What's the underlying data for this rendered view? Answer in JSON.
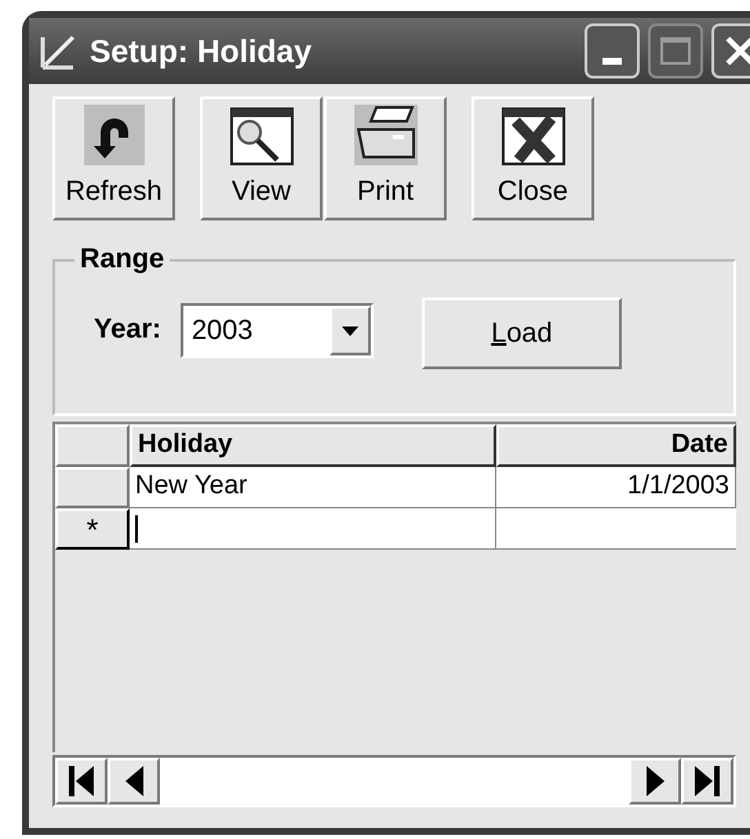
{
  "window": {
    "title": "Setup: Holiday"
  },
  "toolbar": [
    {
      "kind": "refresh",
      "label": "Refresh"
    },
    {
      "kind": "view",
      "label": "View"
    },
    {
      "kind": "print",
      "label": "Print"
    },
    {
      "kind": "close",
      "label": "Close"
    }
  ],
  "range": {
    "title": "Range",
    "year_label": "Year:",
    "year_value": "2003",
    "load_button": {
      "mnemonic": "L",
      "rest": "oad"
    }
  },
  "table": {
    "columns": [
      "Holiday",
      "Date"
    ],
    "rows": [
      {
        "cells": [
          "New Year",
          "1/1/2003"
        ]
      }
    ],
    "new_row": {
      "indicator": "*",
      "editing": true
    }
  }
}
